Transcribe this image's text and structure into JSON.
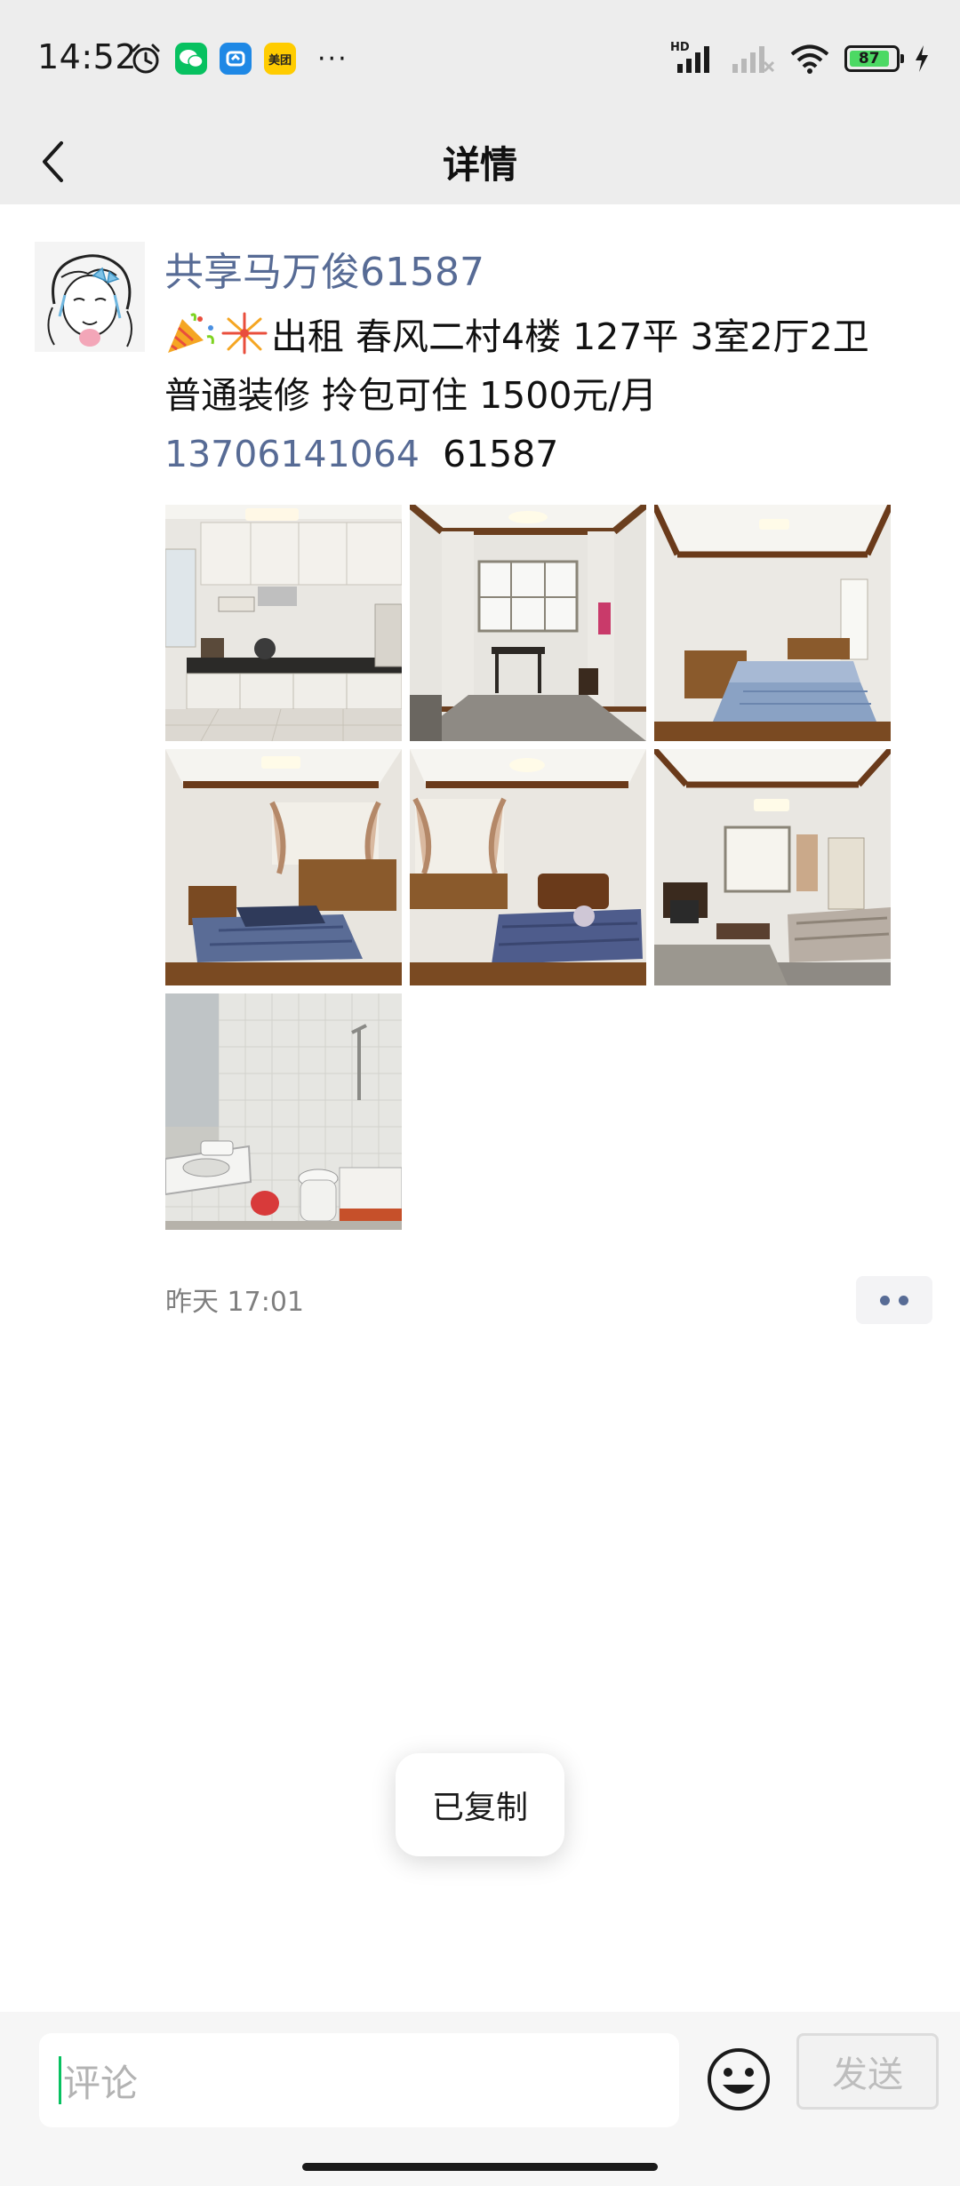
{
  "status_bar": {
    "time": "14:52",
    "battery_level": "87",
    "meituan_label": "美团",
    "more_indicator": "···",
    "network_label": "HD",
    "icons": [
      "alarm-icon",
      "wechat-icon",
      "bili-icon",
      "meituan-icon",
      "signal-icon",
      "signal-disabled-icon",
      "wifi-icon",
      "battery-icon",
      "charging-icon"
    ]
  },
  "nav": {
    "title": "详情",
    "back_icon": "chevron-left-icon"
  },
  "post": {
    "author": "共享马万俊61587",
    "emojis": [
      "party-popper-icon",
      "fireworks-icon"
    ],
    "text_line1": "出租 春风二村4楼 127平 3室2厅2卫",
    "text_line2": "普通装修 拎包可住 1500元/月",
    "phone": "13706141064",
    "code": "61587",
    "photos": [
      {
        "name": "photo-kitchen"
      },
      {
        "name": "photo-dining-room"
      },
      {
        "name": "photo-bedroom-1"
      },
      {
        "name": "photo-bedroom-2"
      },
      {
        "name": "photo-bedroom-3"
      },
      {
        "name": "photo-living-room"
      },
      {
        "name": "photo-bathroom"
      }
    ],
    "timestamp": "昨天 17:01"
  },
  "toast": {
    "text": "已复制"
  },
  "comment_bar": {
    "placeholder": "评论",
    "send_label": "发送"
  },
  "colors": {
    "link": "#576b95",
    "nav_bg": "#ededed",
    "accent_green": "#07c160"
  }
}
